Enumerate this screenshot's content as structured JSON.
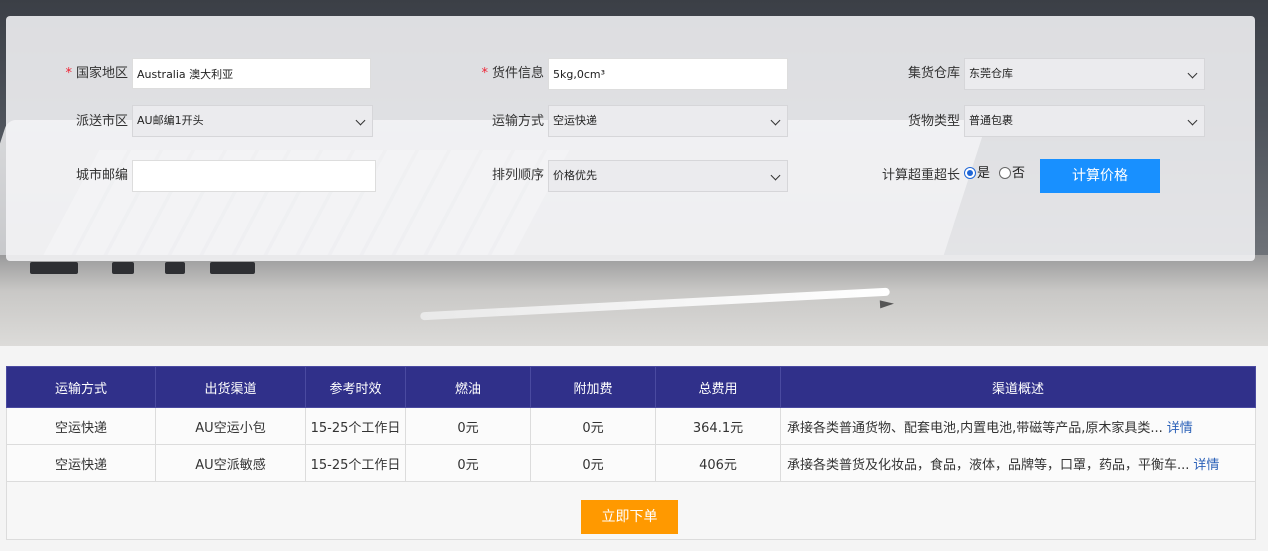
{
  "form": {
    "country": {
      "label": "国家地区",
      "value": "Australia 澳大利亚"
    },
    "cargo_info": {
      "label": "货件信息",
      "value": "5kg,0cm³"
    },
    "warehouse": {
      "label": "集货仓库",
      "value": "东莞仓库"
    },
    "city_area": {
      "label": "派送市区",
      "value": "AU邮编1开头"
    },
    "shipping_method": {
      "label": "运输方式",
      "value": "空运快递"
    },
    "cargo_type": {
      "label": "货物类型",
      "value": "普通包裹"
    },
    "postcode": {
      "label": "城市邮编",
      "value": ""
    },
    "sort_order": {
      "label": "排列顺序",
      "value": "价格优先"
    },
    "oversize": {
      "label": "计算超重超长",
      "yes": "是",
      "no": "否",
      "selected": "yes"
    },
    "required_mark": "*",
    "calc_button": "计算价格"
  },
  "table": {
    "headers": [
      "运输方式",
      "出货渠道",
      "参考时效",
      "燃油",
      "附加费",
      "总费用",
      "渠道概述"
    ],
    "rows": [
      {
        "method": "空运快递",
        "channel": "AU空运小包",
        "time": "15-25个工作日",
        "fuel": "0元",
        "surcharge": "0元",
        "total": "364.1元",
        "desc": "承接各类普通货物、配套电池,内置电池,带磁等产品,原木家具类...",
        "more": "详情"
      },
      {
        "method": "空运快递",
        "channel": "AU空派敏感",
        "time": "15-25个工作日",
        "fuel": "0元",
        "surcharge": "0元",
        "total": "406元",
        "desc": "承接各类普货及化妆品，食品，液体，品牌等，口罩，药品，平衡车...",
        "more": "详情"
      }
    ]
  },
  "order_button": "立即下单",
  "colors": {
    "header_bg": "#30308a",
    "calc_button": "#1890ff",
    "order_button": "#ff9900",
    "required": "#ee2233",
    "link": "#2b61b8"
  }
}
